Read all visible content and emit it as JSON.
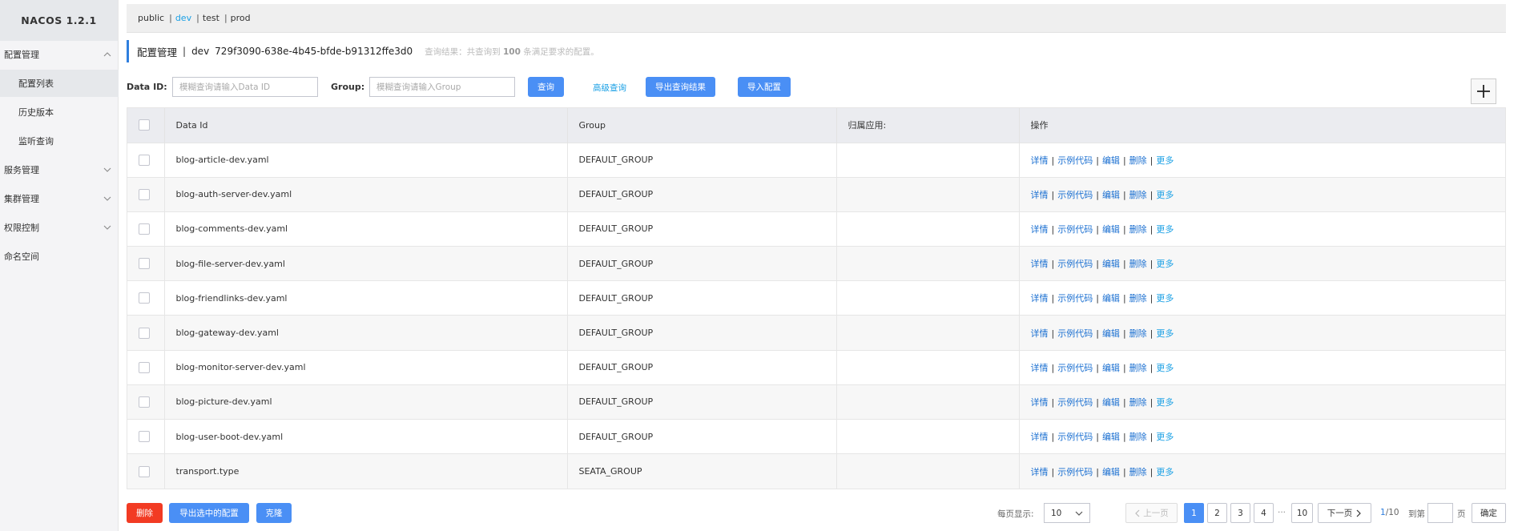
{
  "app": {
    "title": "NACOS 1.2.1"
  },
  "sidebar": {
    "items": [
      {
        "label": "配置管理",
        "chevron": "up"
      },
      {
        "label": "配置列表",
        "sub": true,
        "active": true
      },
      {
        "label": "历史版本",
        "sub": true
      },
      {
        "label": "监听查询",
        "sub": true
      },
      {
        "label": "服务管理",
        "chevron": "down"
      },
      {
        "label": "集群管理",
        "chevron": "down"
      },
      {
        "label": "权限控制",
        "chevron": "down"
      },
      {
        "label": "命名空间"
      }
    ]
  },
  "envs": {
    "items": [
      {
        "label": "public",
        "active": false
      },
      {
        "label": "dev",
        "active": true
      },
      {
        "label": "test",
        "active": false
      },
      {
        "label": "prod",
        "active": false
      }
    ],
    "separator": "|"
  },
  "titlebar": {
    "title": "配置管理",
    "separator": "|",
    "env": "dev",
    "namespace": "729f3090-638e-4b45-bfde-b91312ffe3d0",
    "info_prefix": "查询结果：共查询到",
    "info_count": "100",
    "info_suffix": "条满足要求的配置。"
  },
  "search": {
    "dataid_label": "Data ID:",
    "dataid_placeholder": "模糊查询请输入Data ID",
    "group_label": "Group:",
    "group_placeholder": "模糊查询请输入Group",
    "query_button": "查询",
    "advanced_link": "高级查询",
    "export_results_button": "导出查询结果",
    "import_button": "导入配置"
  },
  "table": {
    "headers": {
      "dataid": "Data Id",
      "group": "Group",
      "app": "归属应用:",
      "ops": "操作"
    },
    "ops": {
      "detail": "详情",
      "sample": "示例代码",
      "edit": "编辑",
      "delete": "删除",
      "more": "更多",
      "sep": "|"
    },
    "rows": [
      {
        "dataid": "blog-article-dev.yaml",
        "group": "DEFAULT_GROUP",
        "app": ""
      },
      {
        "dataid": "blog-auth-server-dev.yaml",
        "group": "DEFAULT_GROUP",
        "app": ""
      },
      {
        "dataid": "blog-comments-dev.yaml",
        "group": "DEFAULT_GROUP",
        "app": ""
      },
      {
        "dataid": "blog-file-server-dev.yaml",
        "group": "DEFAULT_GROUP",
        "app": ""
      },
      {
        "dataid": "blog-friendlinks-dev.yaml",
        "group": "DEFAULT_GROUP",
        "app": ""
      },
      {
        "dataid": "blog-gateway-dev.yaml",
        "group": "DEFAULT_GROUP",
        "app": ""
      },
      {
        "dataid": "blog-monitor-server-dev.yaml",
        "group": "DEFAULT_GROUP",
        "app": ""
      },
      {
        "dataid": "blog-picture-dev.yaml",
        "group": "DEFAULT_GROUP",
        "app": ""
      },
      {
        "dataid": "blog-user-boot-dev.yaml",
        "group": "DEFAULT_GROUP",
        "app": ""
      },
      {
        "dataid": "transport.type",
        "group": "SEATA_GROUP",
        "app": ""
      }
    ]
  },
  "bottom": {
    "delete_button": "删除",
    "export_selected_button": "导出选中的配置",
    "clone_button": "克隆"
  },
  "pagination": {
    "page_size_label": "每页显示:",
    "page_size": "10",
    "prev": "上一页",
    "pages": [
      "1",
      "2",
      "3",
      "4"
    ],
    "ellipsis": "···",
    "last_page": "10",
    "next": "下一页",
    "current": "1",
    "total": "/10",
    "goto_label": "到第",
    "page_unit": "页",
    "confirm": "确定"
  },
  "colors": {
    "accent": "#4a8ff5",
    "link": "#1aa0e5",
    "danger": "#f23b23"
  },
  "icons": {
    "plus": "plus-icon",
    "chevron_up": "chevron-up-icon",
    "chevron_down": "chevron-down-icon"
  }
}
